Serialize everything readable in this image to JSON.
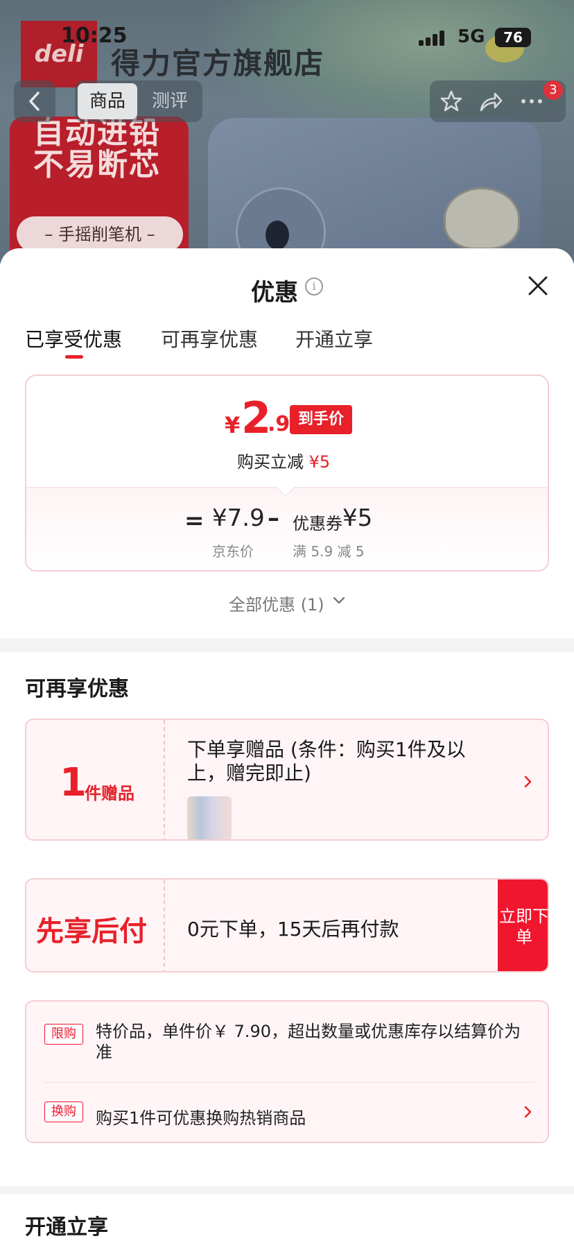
{
  "status_bar": {
    "time": "10:25",
    "network": "5G",
    "battery": "76"
  },
  "background_page": {
    "brand_logo_text": "deli",
    "store_name": "得力官方旗舰店",
    "nav_tabs": [
      "商品",
      "测评"
    ],
    "cart_badge": "3",
    "promo_lines": [
      "自动进铅",
      "不易断芯"
    ],
    "promo_pill": "– 手摇削笔机 –"
  },
  "sheet": {
    "title": "优惠",
    "tabs": [
      "已享受优惠",
      "可再享优惠",
      "开通立享"
    ],
    "enjoyed": {
      "currency": "¥",
      "price_int": "2",
      "price_dec": ".9",
      "badge": "到手价",
      "reduce_label": "购买立减",
      "reduce_amount": "¥5",
      "equals": "=",
      "base_price": "¥7.9",
      "base_label": "京东价",
      "minus": "–",
      "coupon_label": "优惠券",
      "coupon_amount": "¥5",
      "coupon_cond": "满 5.9 减 5"
    },
    "all_deals_label": "全部优惠 (1)",
    "more_section": {
      "title": "可再享优惠",
      "gift": {
        "count": "1",
        "unit": "件赠品",
        "title": "下单享赠品 (条件：购买1件及以上，赠完即止)"
      },
      "bnpl": {
        "name": "先享后付",
        "desc": "0元下单，15天后再付款",
        "button": "立即下单"
      },
      "limit": {
        "tag": "限购",
        "text": "特价品，单件价￥ 7.90，超出数量或优惠库存以结算价为准",
        "swap_tag": "换购",
        "swap_text": "购买1件可优惠换购热销商品"
      }
    },
    "open_section": {
      "title": "开通立享"
    }
  },
  "colors": {
    "accent": "#e8202a",
    "card_border": "#f5cdd1",
    "card_bg": "#fff5f6"
  }
}
